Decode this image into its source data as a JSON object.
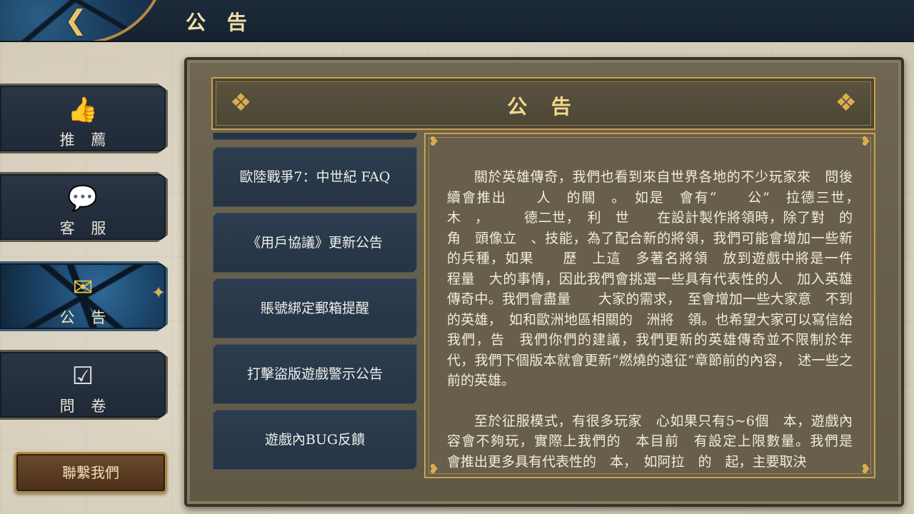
{
  "header": {
    "back_icon": "back-arrow-icon",
    "title": "公 告"
  },
  "nav": {
    "items": [
      {
        "label": "推 薦",
        "icon": "thumbs-up-icon",
        "glyph": "👍",
        "active": false
      },
      {
        "label": "客 服",
        "icon": "customer-service-icon",
        "glyph": "💬",
        "active": false
      },
      {
        "label": "公 告",
        "icon": "announcement-icon",
        "glyph": "✉",
        "active": true
      },
      {
        "label": "問 卷",
        "icon": "survey-icon",
        "glyph": "☑",
        "active": false
      }
    ],
    "contact_label": "聯繫我們"
  },
  "panel": {
    "title": "公 告"
  },
  "notices": [
    {
      "title": "歐陸戰爭7：中世紀 FAQ"
    },
    {
      "title": "《用戶協議》更新公告"
    },
    {
      "title": "賬號綁定郵箱提醒"
    },
    {
      "title": "打擊盜版遊戲警示公告"
    },
    {
      "title": "遊戲內BUG反饋"
    }
  ],
  "content": {
    "paragraphs": [
      "關於英雄傳奇，我們也看到來自世界各地的不少玩家來　問後續會推出　　人　的關　。　如是　會有“　　公”　拉德三世，　木　，　　　德二世，　利　世　　在設計製作將領時，除了對　的角　頭像立　、技能，為了配合新的將領，我們可能會增加一些新的兵種，如果　　歷　上這　多著名將領　放到遊戲中將是一件　程量　大的事情，因此我們會挑選一些具有代表性的人　加入英雄傳奇中。我們會盡量　　大家的需求，　至會增加一些大家意　不到的英雄，　如和歐洲地區相關的　洲將　領。也希望大家可以寫信給我們，告　我們你們的建議，我們更新的英雄傳奇並不限制於年代，我們下個版本就會更新“燃燒的遠征”章節前的內容，　述一些之前的英雄。",
      "至於征服模式，有很多玩家　心如果只有5~6個　本，遊戲內容會不夠玩，實際上我們的　本目前　有設定上限數量。我們是　會推出更多具有代表性的　本，　如阿拉　的　起，主要取決"
    ]
  },
  "colors": {
    "accent_gold": "#d9ae4f",
    "nav_bg": "#1f2937",
    "panel_bg": "#675f4c"
  }
}
